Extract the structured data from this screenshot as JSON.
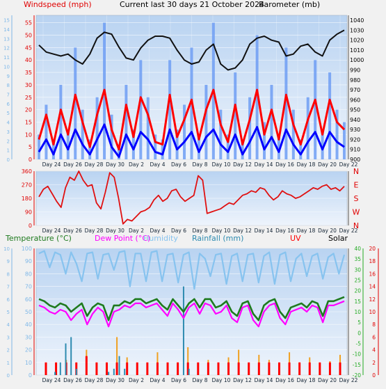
{
  "header": {
    "windspeed_label": "Windspeed (mph)",
    "title": "Current last 30 days 21 October 2024",
    "barometer_label": "Barometer (mb)"
  },
  "colors": {
    "background": "#f1f1f1",
    "plot_top": "#b9d3f1",
    "plot_bottom": "#eef4fc",
    "gust": "#6f9ef3",
    "wind_max": "#ff0000",
    "wind_avg": "#0000ff",
    "pressure": "#111111",
    "direction": "#e01010",
    "temperature": "#1e7a1e",
    "dewpoint": "#ff00ff",
    "humidity": "#87c3ef",
    "rainfall": "#2e8bb0",
    "uv": "#ff0000",
    "solar": "#f0a020",
    "temp_axis": "#22aa22",
    "left_axis": "#7fb8e8"
  },
  "legend2": {
    "temperature": "Temperature (°C)",
    "dewpoint": "Dew Point (°C)",
    "humidity": "Humidity",
    "rainfall": "Rainfall (mm)",
    "uv": "UV",
    "solar": "Solar"
  },
  "chart_data": [
    {
      "type": "line",
      "title": "Current last 30 days 21 October 2024",
      "x_ticks": [
        "Day 24",
        "Day 26",
        "Day 28",
        "Day 30",
        "Day 2",
        "Day 4",
        "Day 6",
        "Day 8",
        "Day 10",
        "Day 12",
        "Day 14",
        "Day 16",
        "Day 18",
        "Day 20",
        "Day 22"
      ],
      "y_left_label": "Windspeed (mph)",
      "y_left_ticks": [
        0,
        5,
        10,
        15,
        20,
        25,
        30,
        35,
        40,
        45,
        50,
        55
      ],
      "y_left_ticks_alt": [
        0,
        1,
        2,
        3,
        4,
        5,
        6,
        7,
        8,
        9,
        10,
        11,
        12,
        13,
        14,
        15
      ],
      "y_right_label": "Barometer (mb)",
      "y_right_ticks": [
        900,
        910,
        920,
        930,
        940,
        950,
        960,
        970,
        980,
        990,
        1000,
        1010,
        1020,
        1030,
        1040
      ],
      "ylim_left": [
        0,
        58
      ],
      "ylim_right": [
        900,
        1045
      ],
      "series": [
        {
          "name": "Barometer (mb)",
          "values": [
            1015,
            1008,
            1006,
            1004,
            1006,
            1000,
            996,
            1006,
            1022,
            1028,
            1026,
            1013,
            1002,
            1000,
            1012,
            1020,
            1024,
            1024,
            1022,
            1010,
            1000,
            996,
            998,
            1010,
            1016,
            996,
            990,
            992,
            1000,
            1016,
            1022,
            1024,
            1020,
            1018,
            1004,
            1006,
            1014,
            1016,
            1008,
            1004,
            1020,
            1026,
            1030
          ]
        },
        {
          "name": "Wind gust (mph)",
          "values": [
            10,
            22,
            8,
            30,
            12,
            45,
            20,
            8,
            25,
            55,
            18,
            6,
            30,
            12,
            40,
            25,
            10,
            8,
            40,
            12,
            22,
            45,
            10,
            30,
            55,
            20,
            10,
            35,
            8,
            25,
            50,
            15,
            30,
            10,
            45,
            20,
            8,
            25,
            40,
            12,
            35,
            20,
            15
          ]
        },
        {
          "name": "Wind max (mph)",
          "values": [
            8,
            18,
            6,
            20,
            10,
            26,
            15,
            5,
            18,
            28,
            12,
            4,
            22,
            9,
            25,
            18,
            7,
            6,
            26,
            9,
            16,
            24,
            8,
            20,
            28,
            14,
            7,
            22,
            6,
            16,
            28,
            10,
            20,
            8,
            26,
            14,
            6,
            16,
            24,
            10,
            24,
            15,
            12
          ]
        },
        {
          "name": "Wind avg (mph)",
          "values": [
            3,
            8,
            2,
            10,
            4,
            12,
            6,
            2,
            8,
            14,
            5,
            1,
            10,
            4,
            11,
            8,
            3,
            2,
            12,
            4,
            7,
            11,
            3,
            9,
            12,
            6,
            3,
            10,
            2,
            7,
            13,
            4,
            9,
            3,
            12,
            6,
            2,
            7,
            11,
            4,
            11,
            7,
            5
          ]
        }
      ]
    },
    {
      "type": "line",
      "x_ticks": [
        "Day 24",
        "Day 26",
        "Day 28",
        "Day 30",
        "Day 2",
        "Day 4",
        "Day 6",
        "Day 8",
        "Day 10",
        "Day 12",
        "Day 14",
        "Day 16",
        "Day 18",
        "Day 20",
        "Day 22"
      ],
      "y_left_ticks": [
        0,
        90,
        180,
        270,
        360
      ],
      "y_right_ticks": [
        "N",
        "W",
        "S",
        "E",
        "N"
      ],
      "ylim": [
        0,
        360
      ],
      "series": [
        {
          "name": "Wind direction (deg)",
          "values": [
            190,
            240,
            260,
            210,
            160,
            120,
            250,
            320,
            300,
            360,
            300,
            260,
            270,
            150,
            110,
            220,
            350,
            320,
            180,
            10,
            40,
            30,
            60,
            90,
            100,
            120,
            170,
            200,
            160,
            180,
            230,
            240,
            190,
            160,
            180,
            200,
            330,
            300,
            80,
            90,
            100,
            110,
            130,
            150,
            140,
            170,
            200,
            210,
            230,
            220,
            250,
            240,
            200,
            170,
            190,
            230,
            210,
            200,
            180,
            190,
            210,
            230,
            250,
            240,
            260,
            270,
            240,
            250,
            230,
            260
          ]
        }
      ]
    },
    {
      "type": "line",
      "x_ticks": [
        "Day 24",
        "Day 26",
        "Day 28",
        "Day 30",
        "Day 2",
        "Day 4",
        "Day 6",
        "Day 8",
        "Day 10",
        "Day 12",
        "Day 14",
        "Day 16",
        "Day 18",
        "Day 20",
        "Day 22"
      ],
      "y_left_ticks": [
        0,
        10,
        20,
        30,
        40,
        50,
        60,
        70,
        80,
        90,
        100
      ],
      "y_temp_ticks": [
        -20,
        -15,
        -10,
        -5,
        0,
        5,
        10,
        15,
        20,
        25,
        30,
        35,
        40
      ],
      "y_right_ticks": [
        0,
        2,
        4,
        6,
        8,
        10,
        12,
        14,
        16,
        18,
        20
      ],
      "ylim_humidity": [
        0,
        100
      ],
      "ylim_temp": [
        -20,
        40
      ],
      "ylim_right": [
        0,
        20
      ],
      "series": [
        {
          "name": "Humidity",
          "values": [
            96,
            98,
            85,
            97,
            95,
            80,
            97,
            88,
            74,
            96,
            97,
            76,
            95,
            96,
            83,
            97,
            98,
            70,
            96,
            96,
            74,
            97,
            98,
            74,
            95,
            96,
            73,
            95,
            97,
            68,
            96,
            92,
            78,
            95,
            96,
            72,
            94,
            96,
            74,
            95,
            96,
            73,
            94,
            97,
            72,
            95,
            97,
            74,
            92,
            96,
            78,
            94,
            96,
            76,
            93,
            96,
            80,
            95
          ]
        },
        {
          "name": "Temperature (°C)",
          "values": [
            16,
            15,
            13,
            12,
            14,
            13,
            10,
            12,
            14,
            8,
            12,
            14,
            13,
            6,
            13,
            13,
            15,
            14,
            16,
            16,
            14,
            15,
            16,
            13,
            11,
            16,
            13,
            10,
            14,
            16,
            12,
            16,
            16,
            12,
            13,
            15,
            10,
            8,
            14,
            15,
            9,
            6,
            13,
            15,
            16,
            10,
            7,
            12,
            13,
            14,
            12,
            15,
            14,
            8,
            15,
            15,
            16,
            17
          ]
        },
        {
          "name": "Dew Point (°C)",
          "values": [
            13,
            12,
            10,
            9,
            11,
            10,
            6,
            9,
            11,
            4,
            9,
            12,
            10,
            3,
            10,
            11,
            13,
            12,
            14,
            14,
            12,
            13,
            14,
            11,
            8,
            14,
            11,
            7,
            12,
            14,
            9,
            14,
            13,
            9,
            10,
            13,
            7,
            5,
            12,
            13,
            6,
            3,
            10,
            13,
            14,
            7,
            4,
            10,
            11,
            12,
            10,
            13,
            12,
            5,
            13,
            13,
            14,
            15
          ]
        },
        {
          "name": "Rainfall (mm)",
          "values": [
            0,
            0,
            0,
            0.5,
            2,
            5,
            6,
            1,
            0,
            0,
            0,
            0,
            0,
            0.5,
            1,
            3,
            1,
            0,
            0,
            0,
            0,
            0,
            0,
            0,
            0,
            0,
            0,
            14,
            1,
            0,
            0,
            0,
            0,
            0,
            0,
            0,
            0,
            0,
            0,
            0,
            0,
            0,
            0,
            0,
            0,
            0,
            0,
            0,
            0,
            0,
            0,
            0,
            0,
            0,
            0,
            0,
            0,
            0
          ]
        },
        {
          "name": "UV",
          "values": [
            2,
            2,
            2,
            2,
            3,
            2,
            2,
            2,
            2,
            2,
            2,
            2,
            2,
            2,
            2,
            2,
            2,
            2,
            2,
            2,
            2,
            2,
            2,
            2,
            2,
            2,
            2,
            2,
            2,
            2
          ]
        },
        {
          "name": "Solar",
          "values": [
            5,
            8,
            12,
            4,
            20,
            9,
            6,
            30,
            14,
            8,
            5,
            18,
            7,
            10,
            22,
            6,
            12,
            9,
            14,
            20,
            7,
            16,
            12,
            8,
            18,
            10,
            14,
            9,
            11,
            16
          ]
        }
      ]
    }
  ]
}
